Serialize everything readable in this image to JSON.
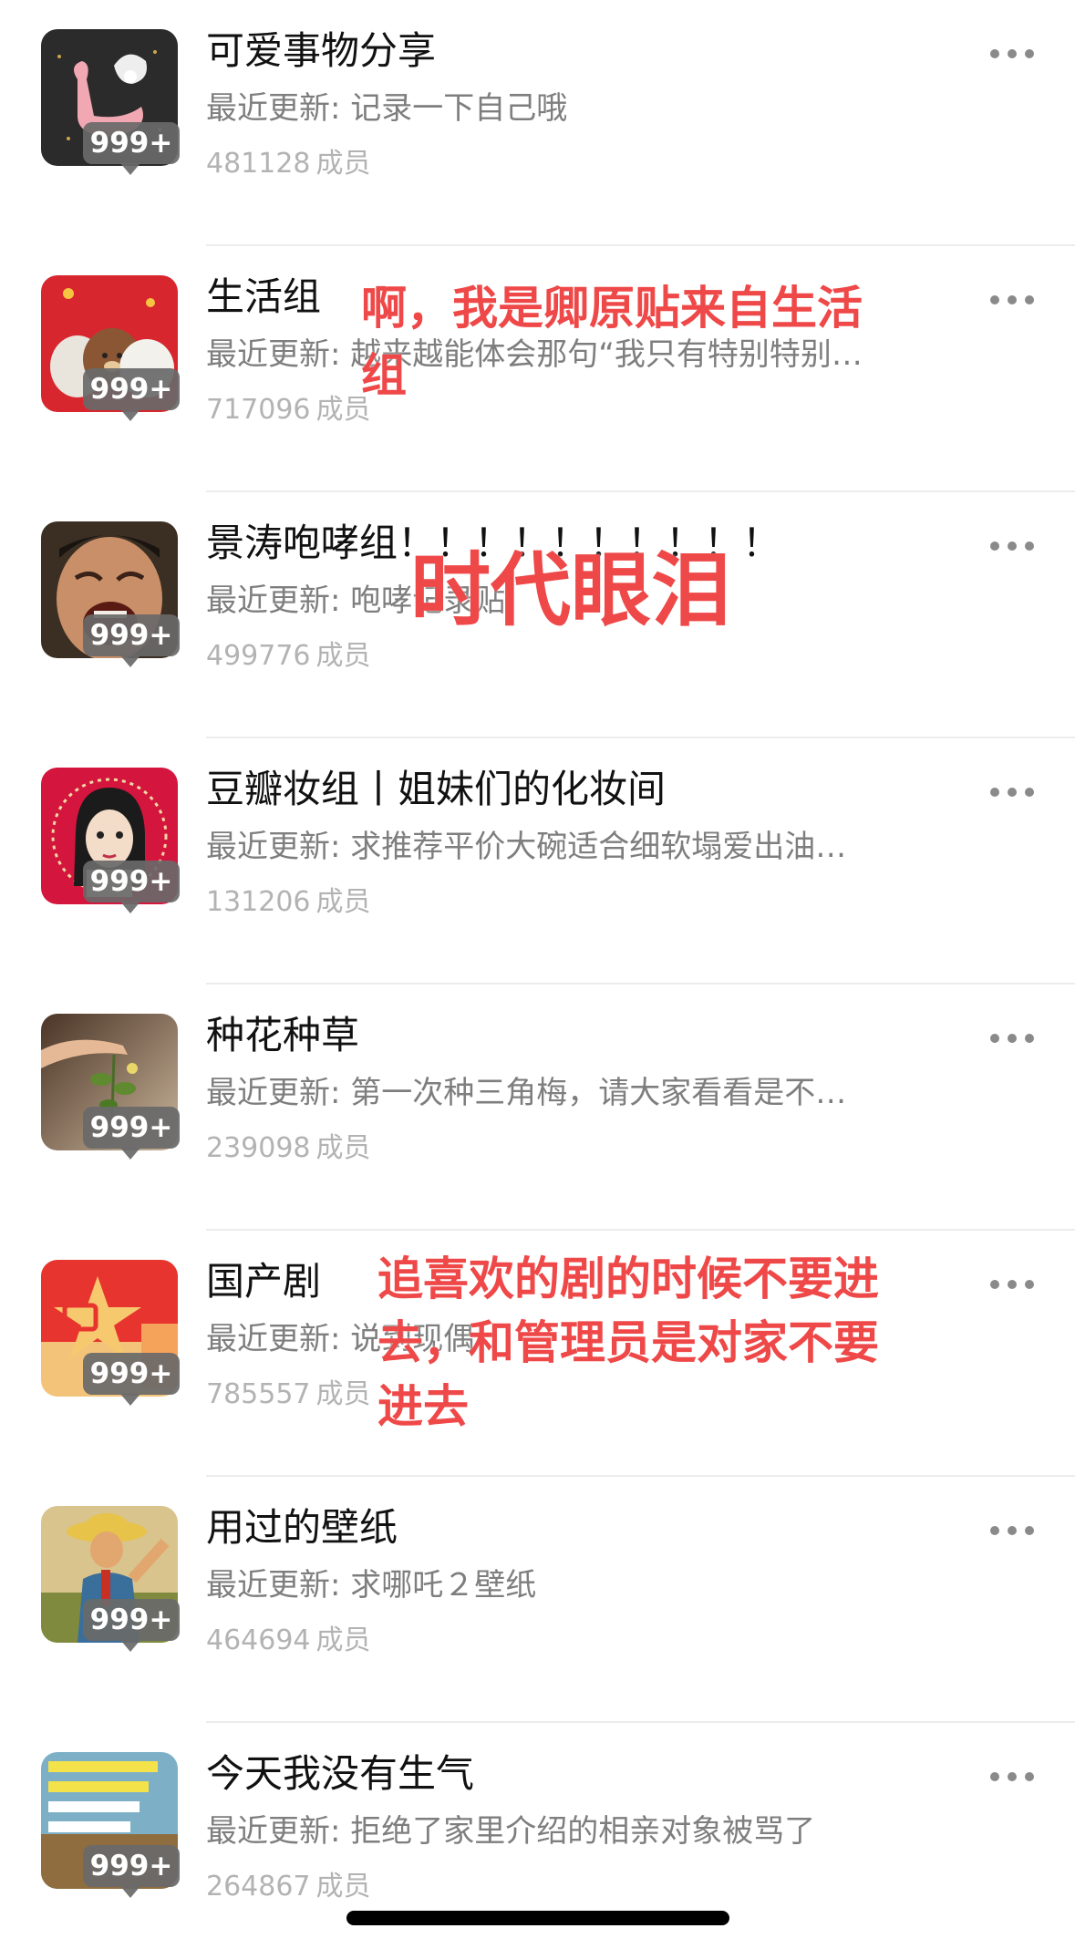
{
  "groups": [
    {
      "name": "可爱事物分享",
      "latest_prefix": "最近更新:",
      "latest": "记录一下自己哦",
      "members": "481128",
      "badge": "999+",
      "avatar_icon": "flamingo-shell-icon"
    },
    {
      "name": "生活组",
      "latest_prefix": "最近更新:",
      "latest": "越来越能体会那句“我只有特别特别…",
      "members": "717096",
      "badge": "999+",
      "avatar_icon": "bears-icon"
    },
    {
      "name": "景涛咆哮组！！！！！！！！！！",
      "latest_prefix": "最近更新:",
      "latest": "咆哮记录贴",
      "members": "499776",
      "badge": "999+",
      "avatar_icon": "crying-man-icon"
    },
    {
      "name": "豆瓣妆组丨姐妹们的化妆间",
      "latest_prefix": "最近更新:",
      "latest": "求推荐平价大碗适合细软塌爱出油…",
      "members": "131206",
      "badge": "999+",
      "avatar_icon": "girl-cartoon-icon"
    },
    {
      "name": "种花种草",
      "latest_prefix": "最近更新:",
      "latest": "第一次种三角梅，请大家看看是不…",
      "members": "239098",
      "badge": "999+",
      "avatar_icon": "plant-sprout-icon"
    },
    {
      "name": "国产剧",
      "latest_prefix": "最近更新:",
      "latest": "说到现偶",
      "members": "785557",
      "badge": "999+",
      "avatar_icon": "tv-star-icon"
    },
    {
      "name": "用过的壁纸",
      "latest_prefix": "最近更新:",
      "latest": "求哪吒２壁纸",
      "members": "464694",
      "badge": "999+",
      "avatar_icon": "poster-farmer-icon"
    },
    {
      "name": "今天我没有生气",
      "latest_prefix": "最近更新:",
      "latest": "拒绝了家里介绍的相亲对象被骂了",
      "members": "264867",
      "badge": "999+",
      "avatar_icon": "text-meme-icon"
    }
  ],
  "members_unit": "成员",
  "annotations": {
    "life_group_line1": "啊，我是卿原贴来自生活",
    "life_group_line2": "组",
    "tears": "时代眼泪",
    "drama_line1": "追喜欢的剧的时候不要进",
    "drama_line2": "去，和管理员是对家不要",
    "drama_line3": "进去"
  },
  "colors": {
    "annotation": "#ef4848",
    "title": "#111111",
    "subtitle": "#7e7e7e",
    "members": "#b3b3b3",
    "badge": "#696969",
    "divider": "#ececec"
  }
}
